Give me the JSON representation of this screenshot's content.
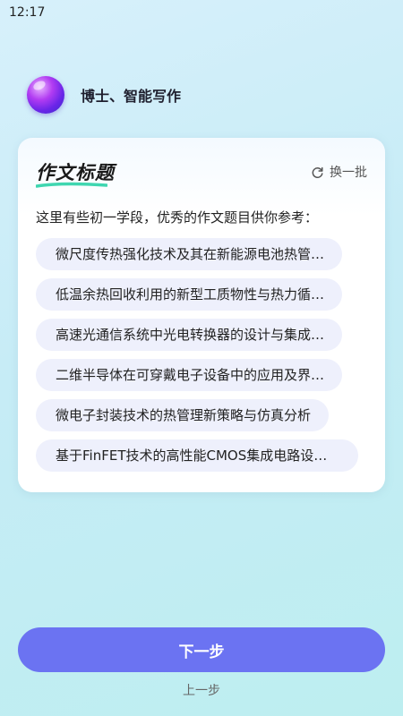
{
  "status_bar": {
    "time": "12:17"
  },
  "brand": {
    "name": "博士、智能写作"
  },
  "card": {
    "title": "作文标题",
    "refresh_label": "换一批",
    "description": "这里有些初一学段，优秀的作文题目供你参考：",
    "topics": [
      "微尺度传热强化技术及其在新能源电池热管…",
      "低温余热回收利用的新型工质物性与热力循…",
      "高速光通信系统中光电转换器的设计与集成…",
      "二维半导体在可穿戴电子设备中的应用及界…",
      "微电子封装技术的热管理新策略与仿真分析",
      "基于FinFET技术的高性能CMOS集成电路设计…"
    ]
  },
  "footer": {
    "next_label": "下一步",
    "prev_label": "上一步"
  },
  "colors": {
    "accent": "#6b73f2",
    "topic_bg": "#eef0fc",
    "underline": "#3fd6b0"
  }
}
